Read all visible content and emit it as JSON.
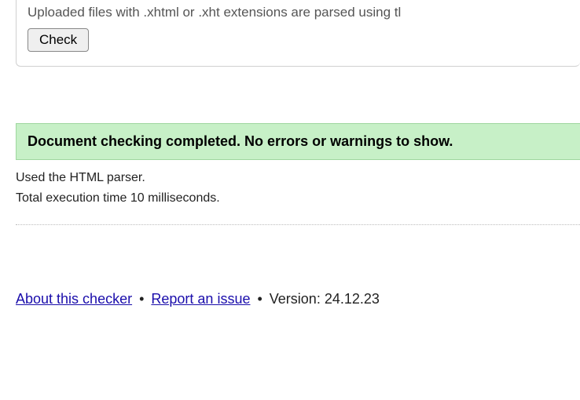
{
  "panel": {
    "hint": "Uploaded files with .xhtml or .xht extensions are parsed using tl",
    "check_label": "Check"
  },
  "status": {
    "message": "Document checking completed. No errors or warnings to show."
  },
  "info": {
    "parser": "Used the HTML parser.",
    "timing": "Total execution time 10 milliseconds."
  },
  "footer": {
    "about_label": "About this checker",
    "report_label": "Report an issue",
    "version_label": "Version: 24.12.23",
    "separator": " • "
  }
}
